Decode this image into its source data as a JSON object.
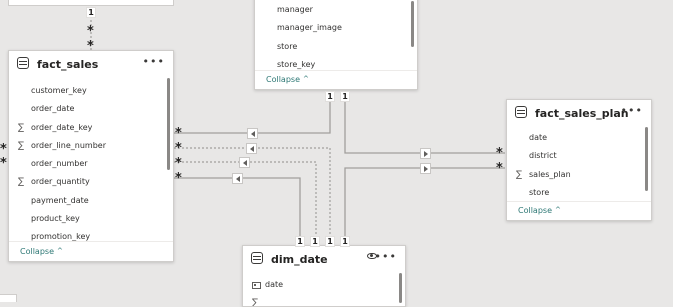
{
  "tables": {
    "fact_sales": {
      "title": "fact_sales",
      "fields": [
        {
          "name": "customer_key",
          "icon": ""
        },
        {
          "name": "order_date",
          "icon": ""
        },
        {
          "name": "order_date_key",
          "icon": "sigma"
        },
        {
          "name": "order_line_number",
          "icon": "sigma"
        },
        {
          "name": "order_number",
          "icon": ""
        },
        {
          "name": "order_quantity",
          "icon": "sigma"
        },
        {
          "name": "payment_date",
          "icon": ""
        },
        {
          "name": "product_key",
          "icon": ""
        },
        {
          "name": "promotion_key",
          "icon": ""
        }
      ],
      "collapse": "Collapse"
    },
    "store_table": {
      "fields": [
        {
          "name": "manager"
        },
        {
          "name": "manager_image"
        },
        {
          "name": "store"
        },
        {
          "name": "store_key"
        }
      ],
      "collapse": "Collapse"
    },
    "fact_sales_plan": {
      "title": "fact_sales_plan",
      "fields": [
        {
          "name": "date",
          "icon": ""
        },
        {
          "name": "district",
          "icon": ""
        },
        {
          "name": "sales_plan",
          "icon": "sigma"
        },
        {
          "name": "store",
          "icon": ""
        }
      ],
      "collapse": "Collapse"
    },
    "dim_date": {
      "title": "dim_date",
      "fields": [
        {
          "name": "date",
          "icon": "date"
        },
        {
          "name": "",
          "icon": "sigma"
        }
      ]
    }
  },
  "cardinality": {
    "one": "1",
    "many": "*"
  },
  "icons": {
    "table": "table-icon",
    "more": "more-options-icon",
    "sigma": "sigma-icon",
    "date": "date-icon",
    "eye": "visibility-icon",
    "chevron": "chevron-up-icon"
  },
  "colors": {
    "canvas": "#e8e7e6",
    "card": "#ffffff",
    "accent": "#2e7875",
    "line": "#a19f9d"
  }
}
